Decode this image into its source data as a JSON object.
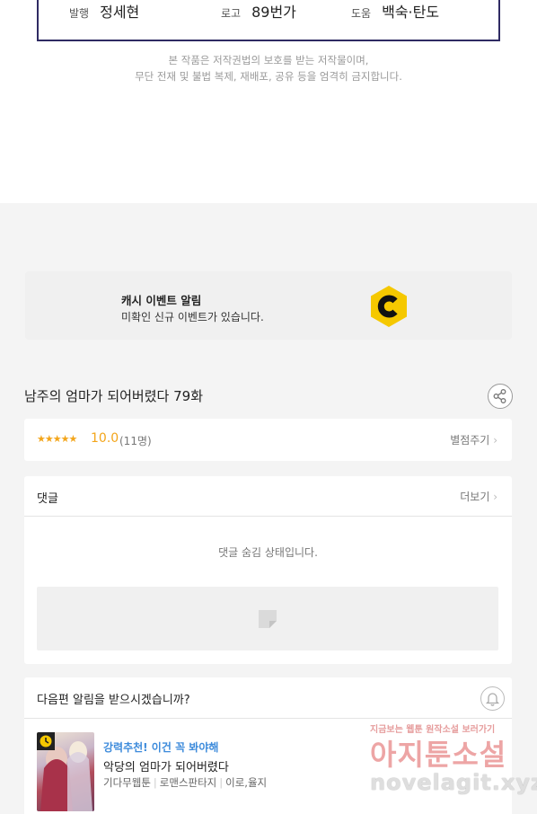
{
  "credits": {
    "publish_label": "발행",
    "publish_value": "정세현",
    "logo_label": "로고",
    "logo_value": "89번가",
    "help_label": "도움",
    "help_value": "백숙·탄도"
  },
  "notice": {
    "line1": "본 작품은 저작권법의 보호를 받는 저작물이며,",
    "line2": "무단 전재 및 불법 복제, 재배포, 공유 등을 엄격히 금지합니다."
  },
  "event": {
    "title": "캐시 이벤트 알림",
    "subtitle": "미확인 신규 이벤트가 있습니다.",
    "icon": "coin-c-icon",
    "accent": "#f5c800"
  },
  "episode": {
    "title": "남주의 엄마가 되어버렸다 79화"
  },
  "rating": {
    "stars": "★★★★★",
    "score": "10.0",
    "votes": "(11명)",
    "rate_link": "별점주기"
  },
  "comments": {
    "heading": "댓글",
    "more_link": "더보기",
    "hidden_message": "댓글 숨김 상태입니다."
  },
  "next_alert": {
    "question": "다음편 알림을 받으시겠습니까?",
    "recommend": "강력추천! 이건 꼭 봐야해",
    "work_title": "악당의 엄마가 되어버렸다",
    "genre1": "기다무웹툰",
    "genre2": "로맨스판타지",
    "authors": "이로,율지"
  },
  "watermark": {
    "top": "지금보는 웹툰 원작소설 보러가기",
    "main": "아지툰소설",
    "url": "novelagit.xyz"
  }
}
